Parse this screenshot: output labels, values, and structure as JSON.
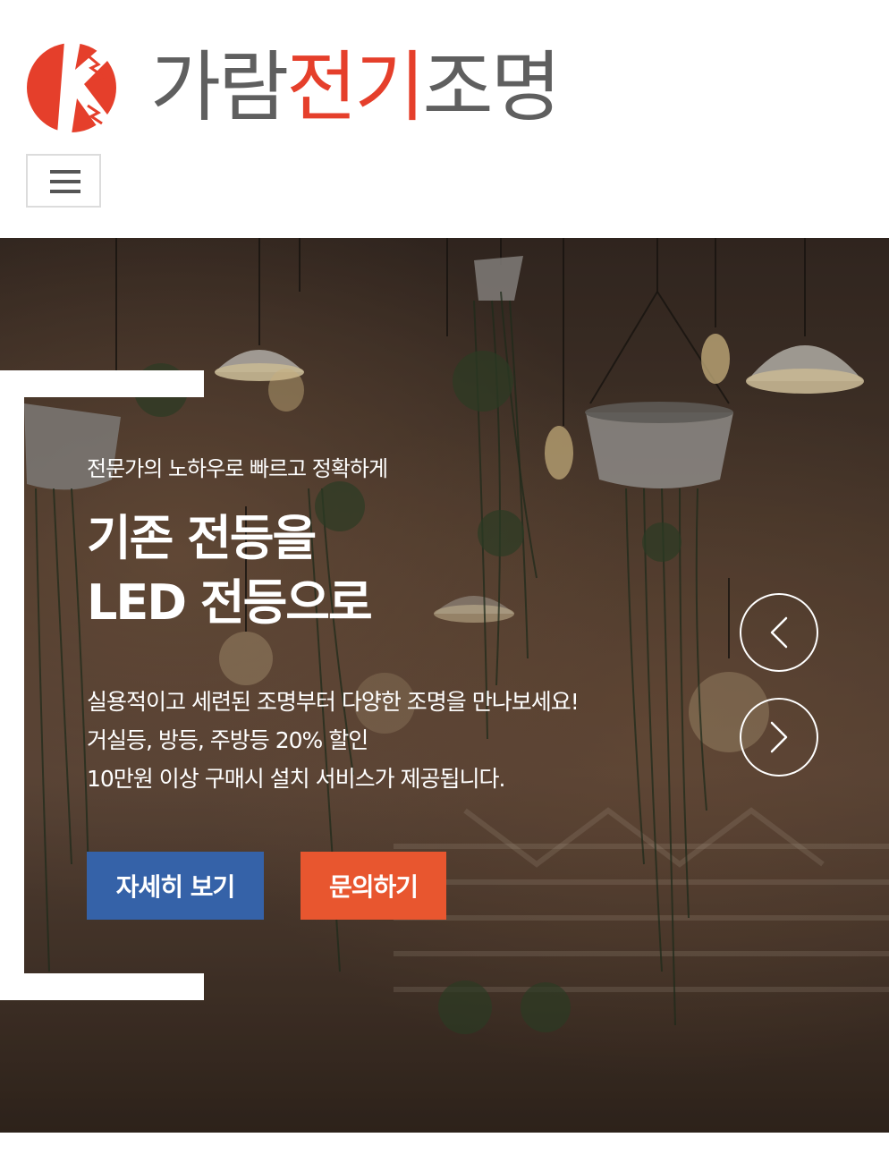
{
  "header": {
    "logo": {
      "letter": "K",
      "name_part1": "가람",
      "name_part2": "전기",
      "name_part3": "조명"
    },
    "menu_toggle_icon": "hamburger-icon"
  },
  "hero": {
    "eyebrow": "전문가의 노하우로 빠르고 정확하게",
    "headline_line1": "기존 전등을",
    "headline_line2": "LED 전등으로",
    "description_lines": [
      "실용적이고 세련된 조명부터 다양한 조명을 만나보세요!",
      "거실등, 방등, 주방등 20% 할인",
      "10만원 이상 구매시 설치 서비스가 제공됩니다."
    ],
    "buttons": {
      "detail": "자세히 보기",
      "inquiry": "문의하기"
    },
    "prev_icon": "chevron-left-icon",
    "next_icon": "chevron-right-icon"
  },
  "colors": {
    "brand_red": "#e53f2b",
    "brand_gray": "#5f5f5f",
    "button_blue": "#3562a8",
    "button_orange": "#e8562f"
  }
}
